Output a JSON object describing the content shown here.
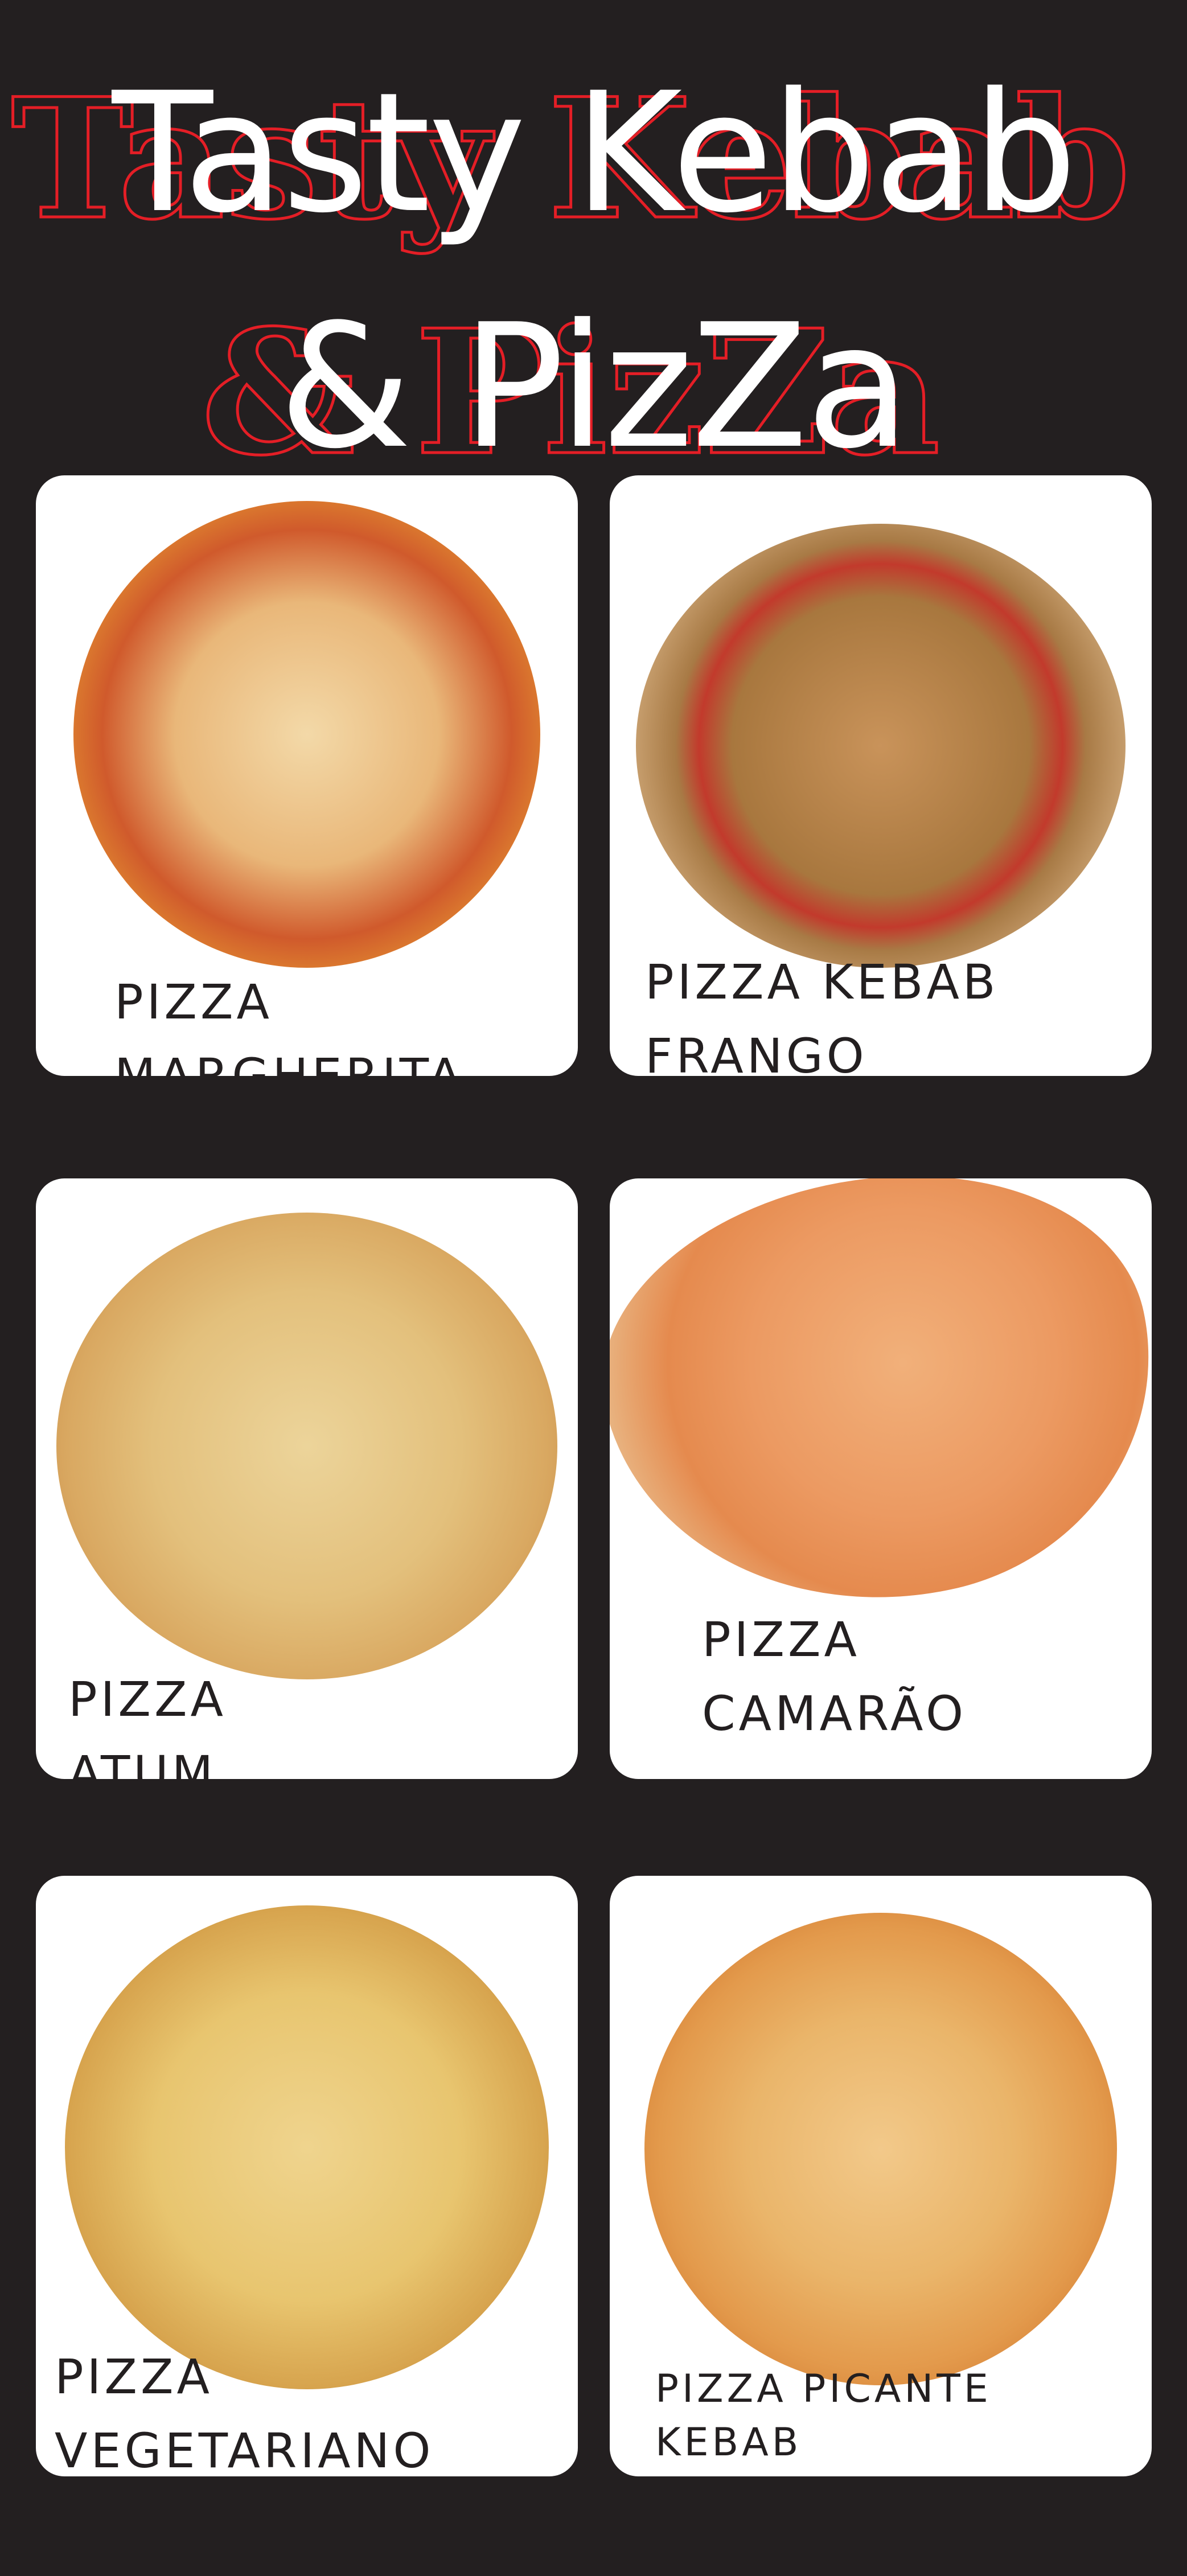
{
  "header": {
    "title_line1": "Tasty Kebab",
    "title_line2": "& PizZa"
  },
  "menu": [
    {
      "line1": "PIZZA",
      "line2": "MARGHERITA",
      "pizza_icon": "pizza-margherita-image"
    },
    {
      "line1": "PIZZA KEBAB",
      "line2": "FRANGO",
      "pizza_icon": "pizza-kebab-frango-image"
    },
    {
      "line1": "PIZZA",
      "line2": "ATUM",
      "pizza_icon": "pizza-atum-image"
    },
    {
      "line1": "PIZZA",
      "line2": "CAMARÃO",
      "pizza_icon": "pizza-camarao-image"
    },
    {
      "line1": "PIZZA",
      "line2": "VEGETARIANO",
      "pizza_icon": "pizza-vegetariano-image"
    },
    {
      "line1": "PIZZA PICANTE",
      "line2": "KEBAB",
      "pizza_icon": "pizza-picante-kebab-image"
    }
  ],
  "colors": {
    "background": "#231f20",
    "accent": "#e41e26",
    "card": "#ffffff"
  }
}
